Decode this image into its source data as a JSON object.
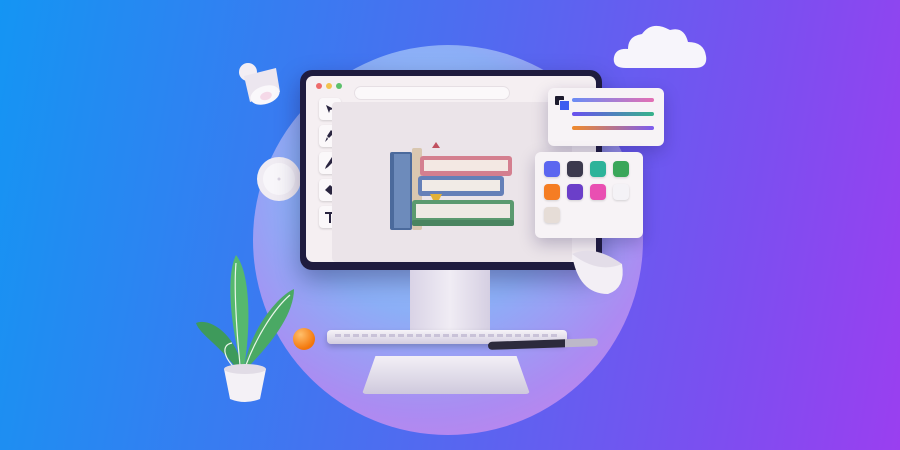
{
  "colors": {
    "background_start": "#1495f3",
    "background_end": "#9a3ff0",
    "monitor_frame": "#1f1c3f",
    "screen": "#f5eff2",
    "window_close": "#ee6b6b",
    "window_minimize": "#f2c24f",
    "window_maximize": "#5cc06b"
  },
  "window": {
    "controls": [
      "close-dot",
      "minimize-dot",
      "maximize-dot"
    ]
  },
  "toolbar": {
    "tools": [
      {
        "name": "select-arrow-icon",
        "glyph": "➤"
      },
      {
        "name": "brush-icon",
        "glyph": "🖌"
      },
      {
        "name": "pencil-icon",
        "glyph": "✎"
      },
      {
        "name": "eraser-icon",
        "glyph": "▰"
      },
      {
        "name": "text-tool-icon",
        "glyph": "T"
      }
    ]
  },
  "canvas": {
    "content": "stacked-books-illustration"
  },
  "gradient_panel": {
    "icon": "layers-color-icon",
    "gradients": [
      [
        "#6a8cf5",
        "#e46fb3"
      ],
      [
        "#6a4ff0",
        "#36b38a"
      ],
      [
        "#f08a2c",
        "#7c5cf0"
      ]
    ]
  },
  "swatch_panel": {
    "swatches": [
      "#5b66f0",
      "#3c3a4e",
      "#2db39a",
      "#3aa65a",
      "#f57d23",
      "#6b3fc9",
      "#e94fb2",
      "#f4f2f6",
      "#e6ddd7"
    ]
  },
  "decorations": [
    "cloud",
    "desk-lamp",
    "wall-clock",
    "bowl",
    "potted-plant",
    "orange-ball",
    "stylus-pen",
    "keyboard"
  ]
}
